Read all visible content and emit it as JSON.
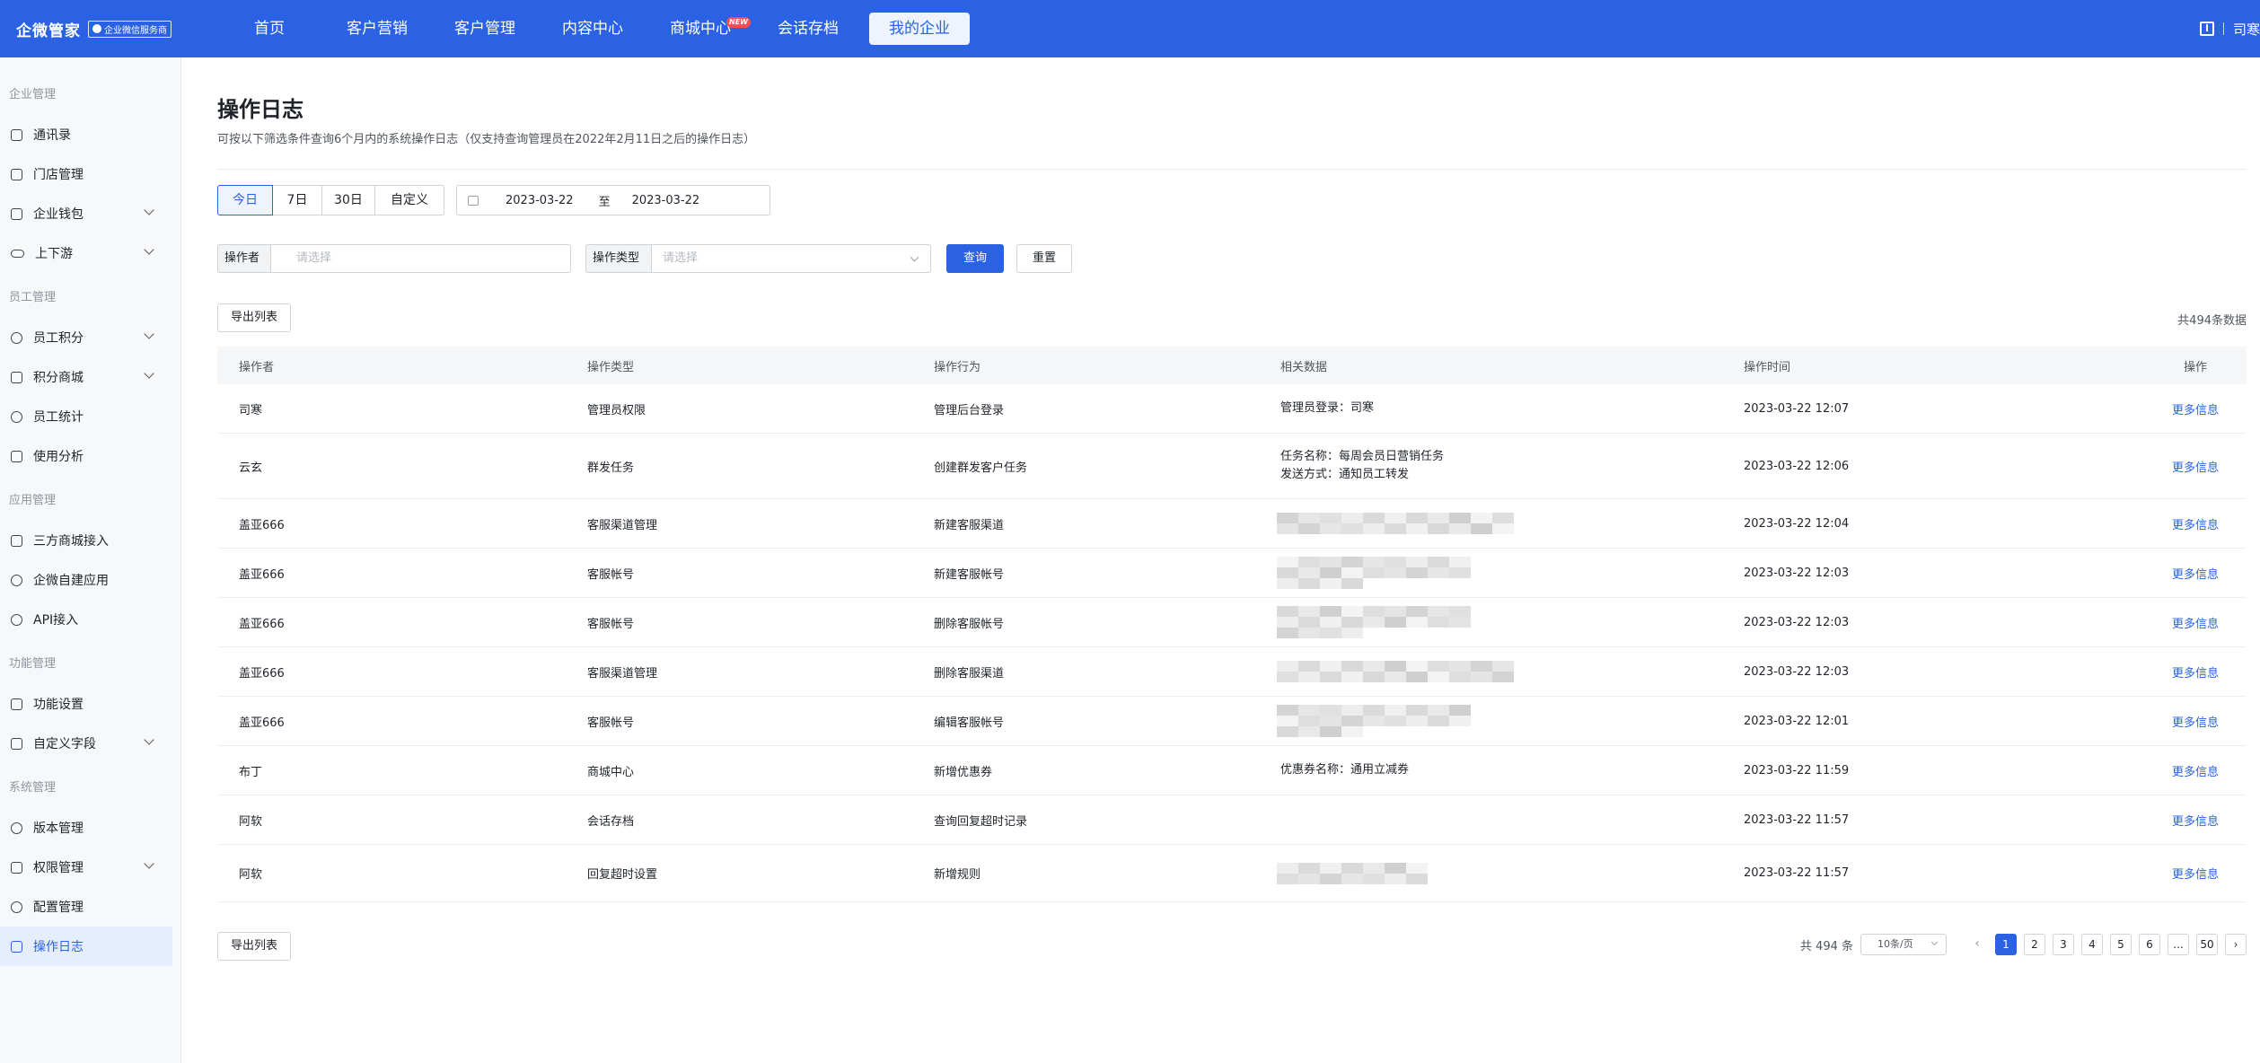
{
  "topbar": {
    "brand": "企微管家",
    "badge": "企业微信服务商",
    "nav": [
      {
        "label": "首页"
      },
      {
        "label": "客户营销"
      },
      {
        "label": "客户管理"
      },
      {
        "label": "内容中心"
      },
      {
        "label": "商城中心",
        "badge": "NEW"
      },
      {
        "label": "会话存档"
      },
      {
        "label": "我的企业",
        "active": true
      }
    ],
    "user": "司寒"
  },
  "sidebar": {
    "groups": [
      {
        "title": "企业管理",
        "items": [
          {
            "label": "通讯录",
            "icon": "contacts-icon"
          },
          {
            "label": "门店管理",
            "icon": "store-icon"
          },
          {
            "label": "企业钱包",
            "icon": "wallet-icon",
            "expandable": true
          },
          {
            "label": "上下游",
            "icon": "link-icon",
            "expandable": true
          }
        ]
      },
      {
        "title": "员工管理",
        "items": [
          {
            "label": "员工积分",
            "icon": "user-icon",
            "expandable": true
          },
          {
            "label": "积分商城",
            "icon": "bag-icon",
            "expandable": true
          },
          {
            "label": "员工统计",
            "icon": "user-icon"
          },
          {
            "label": "使用分析",
            "icon": "chart-icon"
          }
        ]
      },
      {
        "title": "应用管理",
        "items": [
          {
            "label": "三方商城接入",
            "icon": "store-icon"
          },
          {
            "label": "企微自建应用",
            "icon": "hexagon-icon"
          },
          {
            "label": "API接入",
            "icon": "api-icon"
          }
        ]
      },
      {
        "title": "功能管理",
        "items": [
          {
            "label": "功能设置",
            "icon": "sliders-icon"
          },
          {
            "label": "自定义字段",
            "icon": "field-icon",
            "expandable": true
          }
        ]
      },
      {
        "title": "系统管理",
        "items": [
          {
            "label": "版本管理",
            "icon": "layers-icon"
          },
          {
            "label": "权限管理",
            "icon": "shield-icon",
            "expandable": true
          },
          {
            "label": "配置管理",
            "icon": "gear-icon"
          },
          {
            "label": "操作日志",
            "icon": "log-icon",
            "active": true
          }
        ]
      }
    ]
  },
  "page": {
    "title": "操作日志",
    "desc": "可按以下筛选条件查询6个月内的系统操作日志（仅支持查询管理员在2022年2月11日之后的操作日志）"
  },
  "filters": {
    "ranges": [
      "今日",
      "7日",
      "30日",
      "自定义"
    ],
    "range_active": "今日",
    "start_date": "2023-03-22",
    "to": "至",
    "end_date": "2023-03-22",
    "operator_label": "操作者",
    "operator_placeholder": "请选择",
    "type_label": "操作类型",
    "type_placeholder": "请选择",
    "query": "查询",
    "reset": "重置"
  },
  "export_label": "导出列表",
  "total_text": "共494条数据",
  "table": {
    "headers": [
      "操作者",
      "操作类型",
      "操作行为",
      "相关数据",
      "操作时间",
      "操作"
    ],
    "rows": [
      {
        "operator": "司寒",
        "type": "管理员权限",
        "action": "管理后台登录",
        "data": [
          "管理员登录：司寒"
        ],
        "time": "2023-03-22 12:07",
        "op": "更多信息"
      },
      {
        "operator": "云玄",
        "type": "群发任务",
        "action": "创建群发客户任务",
        "data": [
          "任务名称：每周会员日营销任务",
          "发送方式：通知员工转发"
        ],
        "time": "2023-03-22 12:06",
        "op": "更多信息"
      },
      {
        "operator": "盖亚666",
        "type": "客服渠道管理",
        "action": "新建客服渠道",
        "data": [],
        "blurred": true,
        "time": "2023-03-22 12:04",
        "op": "更多信息"
      },
      {
        "operator": "盖亚666",
        "type": "客服帐号",
        "action": "新建客服帐号",
        "data": [],
        "blurred": true,
        "time": "2023-03-22 12:03",
        "op": "更多信息"
      },
      {
        "operator": "盖亚666",
        "type": "客服帐号",
        "action": "删除客服帐号",
        "data": [],
        "blurred": true,
        "time": "2023-03-22 12:03",
        "op": "更多信息"
      },
      {
        "operator": "盖亚666",
        "type": "客服渠道管理",
        "action": "删除客服渠道",
        "data": [],
        "blurred": true,
        "time": "2023-03-22 12:03",
        "op": "更多信息"
      },
      {
        "operator": "盖亚666",
        "type": "客服帐号",
        "action": "编辑客服帐号",
        "data": [],
        "blurred": true,
        "time": "2023-03-22 12:01",
        "op": "更多信息"
      },
      {
        "operator": "布丁",
        "type": "商城中心",
        "action": "新增优惠券",
        "data": [
          "优惠券名称：通用立减券"
        ],
        "time": "2023-03-22 11:59",
        "op": "更多信息"
      },
      {
        "operator": "阿软",
        "type": "会话存档",
        "action": "查询回复超时记录",
        "data": [],
        "time": "2023-03-22 11:57",
        "op": "更多信息"
      },
      {
        "operator": "阿软",
        "type": "回复超时设置",
        "action": "新增规则",
        "data": [],
        "blurred": true,
        "time": "2023-03-22 11:57",
        "op": "更多信息"
      }
    ]
  },
  "pagination": {
    "total": "共 494 条",
    "page_size": "10条/页",
    "pages": [
      "1",
      "2",
      "3",
      "4",
      "5",
      "6",
      "...",
      "50"
    ],
    "current": "1"
  },
  "colors": {
    "primary": "#2a62e3",
    "link": "#2a62e3",
    "sidebar_active_bg": "#e6edfc"
  }
}
